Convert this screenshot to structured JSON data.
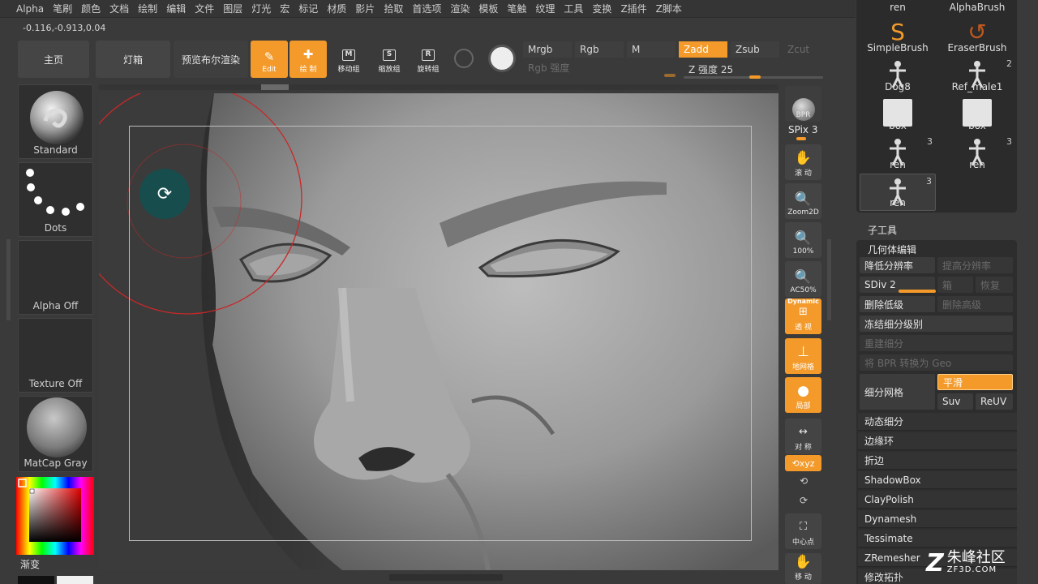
{
  "menu": [
    "Alpha",
    "笔刷",
    "颜色",
    "文档",
    "绘制",
    "编辑",
    "文件",
    "图层",
    "灯光",
    "宏",
    "标记",
    "材质",
    "影片",
    "拾取",
    "首选项",
    "渲染",
    "模板",
    "笔触",
    "纹理",
    "工具",
    "变换",
    "Z插件",
    "Z脚本"
  ],
  "coords": "-0.116,-0.913,0.04",
  "shelf": {
    "home": "主页",
    "lightbox": "灯箱",
    "bpr_preview": "预览布尔渲染",
    "edit": "Edit",
    "draw": "绘 制",
    "move": "移动组",
    "scale": "缩放组",
    "rotate": "旋转组"
  },
  "color_modes": {
    "mrgb": "Mrgb",
    "rgb": "Rgb",
    "m": "M",
    "zadd": "Zadd",
    "zsub": "Zsub",
    "zcut": "Zcut",
    "rgb_intensity": "Rgb 强度",
    "z_intensity": "Z 强度 25",
    "z_intensity_value": 25
  },
  "left_tray": {
    "brush": "Standard",
    "stroke": "Dots",
    "alpha": "Alpha Off",
    "texture": "Texture Off",
    "material": "MatCap Gray",
    "gradient": "渐变"
  },
  "right_tools": {
    "bpr": "BPR",
    "spix": "SPix 3",
    "scroll": "滚 动",
    "zoom2d": "Zoom2D",
    "zoom100": "100%",
    "ac50": "AC50%",
    "dynamic": "Dynamic",
    "persp": "透 视",
    "floor": "地网格",
    "local": "局部",
    "sym": "对 称",
    "xyz": "⟲xyz",
    "center": "中心点",
    "move": "移 动"
  },
  "brush_panel": [
    {
      "label": "ren",
      "count": ""
    },
    {
      "label": "AlphaBrush",
      "count": ""
    },
    {
      "label": "SimpleBrush",
      "count": ""
    },
    {
      "label": "EraserBrush",
      "count": ""
    },
    {
      "label": "Dog8",
      "count": ""
    },
    {
      "label": "Ref_male1",
      "count": "2"
    },
    {
      "label": "box",
      "count": ""
    },
    {
      "label": "box",
      "count": ""
    },
    {
      "label": "ren",
      "count": "3"
    },
    {
      "label": "ren",
      "count": "3"
    },
    {
      "label": "ren",
      "count": "3"
    }
  ],
  "subtool": "子工具",
  "geometry": {
    "header": "几何体编辑",
    "lower_res": "降低分辨率",
    "higher_res": "提高分辨率",
    "sdiv": "SDiv 2",
    "sdiv_value": 2,
    "cage": "箱",
    "restore": "恢复",
    "del_lower": "删除低级",
    "del_higher": "删除高级",
    "freeze": "冻结细分级别",
    "reconstruct": "重建细分",
    "bpr_to_geo": "将 BPR 转换为 Geo",
    "divide": "细分网格",
    "smooth": "平滑",
    "suv": "Suv",
    "reuv": "ReUV",
    "items": [
      "动态细分",
      "边缘环",
      "折边",
      "ShadowBox",
      "ClayPolish",
      "Dynamesh",
      "Tessimate",
      "ZRemesher",
      "修改拓扑"
    ]
  },
  "watermark": {
    "line1": "朱峰社区",
    "line2": "ZF3D.COM"
  },
  "colors": {
    "accent": "#f39a2a",
    "bg": "#3a3a3a",
    "panel": "#2b2b2b"
  }
}
